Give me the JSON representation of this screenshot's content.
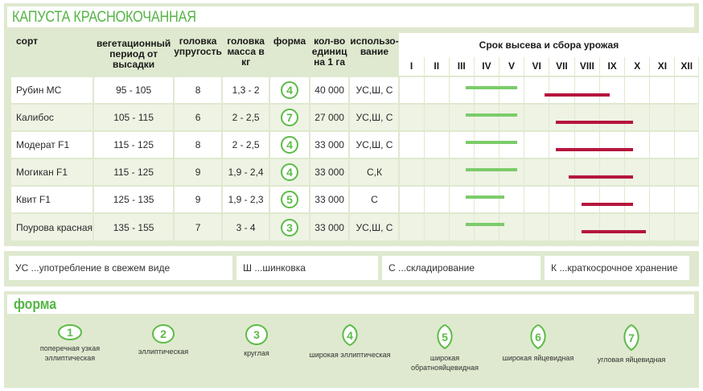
{
  "title": "КАПУСТА КРАСНОКОЧАННАЯ",
  "headers": {
    "variety": "сорт",
    "vegetation": "вегетационный период от высадки",
    "firmness": "головка упругость",
    "mass": "головка масса в кг",
    "shape": "форма",
    "yield": "кол-во единиц на 1 га",
    "usage": "использо- вание",
    "timeline": "Срок высева и сбора урожая"
  },
  "months": [
    "I",
    "II",
    "III",
    "IV",
    "V",
    "VI",
    "VII",
    "VIII",
    "IX",
    "X",
    "XI",
    "XII"
  ],
  "rows": [
    {
      "variety": "Рубин МС",
      "vegetation": "95 - 105",
      "firmness": "8",
      "mass": "1,3 - 2",
      "shape": "4",
      "yield": "40 000",
      "usage": "УС,Ш, С",
      "sow": [
        4.1,
        6.1
      ],
      "harvest": [
        7.15,
        9.7
      ]
    },
    {
      "variety": "Калибос",
      "vegetation": "105 - 115",
      "firmness": "6",
      "mass": "2 - 2,5",
      "shape": "7",
      "yield": "27 000",
      "usage": "УС,Ш, С",
      "sow": [
        4.1,
        6.1
      ],
      "harvest": [
        7.6,
        10.6
      ]
    },
    {
      "variety": "Модерат F1",
      "vegetation": "115 - 125",
      "firmness": "8",
      "mass": "2 - 2,5",
      "shape": "4",
      "yield": "33 000",
      "usage": "УС,Ш, С",
      "sow": [
        4.1,
        6.1
      ],
      "harvest": [
        7.6,
        10.6
      ]
    },
    {
      "variety": "Могикан F1",
      "vegetation": "115 - 125",
      "firmness": "9",
      "mass": "1,9 - 2,4",
      "shape": "4",
      "yield": "33 000",
      "usage": "С,К",
      "sow": [
        4.1,
        6.1
      ],
      "harvest": [
        8.1,
        10.6
      ]
    },
    {
      "variety": "Квит F1",
      "vegetation": "125 - 135",
      "firmness": "9",
      "mass": "1,9 - 2,3",
      "shape": "5",
      "yield": "33 000",
      "usage": "С",
      "sow": [
        4.1,
        5.6
      ],
      "harvest": [
        8.6,
        10.6
      ]
    },
    {
      "variety": "Поурова красная",
      "vegetation": "135 - 155",
      "firmness": "7",
      "mass": "3 - 4",
      "shape": "3",
      "yield": "33 000",
      "usage": "УС,Ш, С",
      "sow": [
        4.1,
        5.6
      ],
      "harvest": [
        8.6,
        11.1
      ]
    }
  ],
  "legend": [
    "УС ...употребление в свежем виде",
    "Ш ...шинковка",
    "С ...складирование",
    "К ...краткосрочное хранение"
  ],
  "shapes_title": "форма",
  "shapes": [
    {
      "num": "1",
      "label": "поперечная узкая эллиптическая"
    },
    {
      "num": "2",
      "label": "эллиптическая"
    },
    {
      "num": "3",
      "label": "круглая"
    },
    {
      "num": "4",
      "label": "широкая эллиптическая"
    },
    {
      "num": "5",
      "label": "широкая обратнояйцевидная"
    },
    {
      "num": "6",
      "label": "широкая яйцевидная"
    },
    {
      "num": "7",
      "label": "угловая яйцевидная"
    }
  ],
  "colors": {
    "accent_green": "#55b545",
    "sow_bar": "#7ccc6a",
    "harvest_bar": "#b5163e",
    "panel_bg": "#dfe9cf"
  }
}
